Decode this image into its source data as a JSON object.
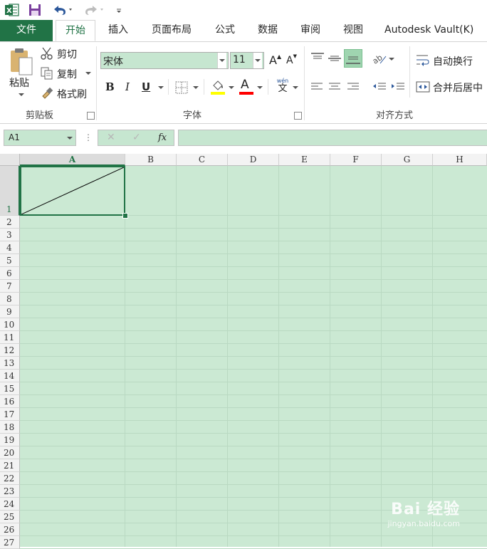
{
  "qat": {
    "icons": [
      "excel-logo-icon",
      "save-icon",
      "undo-icon",
      "redo-icon",
      "customize-qat-icon"
    ]
  },
  "tabs": [
    {
      "label": "文件",
      "key": "file"
    },
    {
      "label": "开始",
      "key": "home"
    },
    {
      "label": "插入",
      "key": "insert"
    },
    {
      "label": "页面布局",
      "key": "page_layout"
    },
    {
      "label": "公式",
      "key": "formulas"
    },
    {
      "label": "数据",
      "key": "data"
    },
    {
      "label": "审阅",
      "key": "review"
    },
    {
      "label": "视图",
      "key": "view"
    },
    {
      "label": "Autodesk Vault(K)",
      "key": "vault"
    }
  ],
  "clipboard": {
    "paste_label": "粘贴",
    "cut_label": "剪切",
    "copy_label": "复制",
    "format_painter_label": "格式刷",
    "group_label": "剪贴板"
  },
  "font": {
    "font_name": "宋体",
    "font_size": "11",
    "grow_glyph": "A",
    "shrink_glyph": "A",
    "bold": "B",
    "italic": "I",
    "underline": "U",
    "font_color_glyph": "A",
    "phonetic_top": "wén",
    "phonetic_bottom": "文",
    "group_label": "字体",
    "fill_color": "#ffff00",
    "font_color": "#ff0000"
  },
  "alignment": {
    "wrap_text_label": "自动换行",
    "merge_center_label": "合并后居中",
    "group_label": "对齐方式"
  },
  "formula_bar": {
    "name_box": "A1",
    "fx_label": "fx",
    "formula": ""
  },
  "sheet": {
    "columns": [
      "A",
      "B",
      "C",
      "D",
      "E",
      "F",
      "G",
      "H"
    ],
    "rows": [
      "1",
      "2",
      "3",
      "4",
      "5",
      "6",
      "7",
      "8",
      "9",
      "10",
      "11",
      "12",
      "13",
      "14",
      "15",
      "16",
      "17",
      "18",
      "19",
      "20",
      "21",
      "22",
      "23",
      "24",
      "25",
      "26",
      "27"
    ],
    "active_cell": "A1"
  },
  "watermark": {
    "brand": "Bai  经验",
    "url": "jingyan.baidu.com"
  },
  "colors": {
    "accent": "#217346",
    "cell_fill": "#cbe9d3"
  }
}
